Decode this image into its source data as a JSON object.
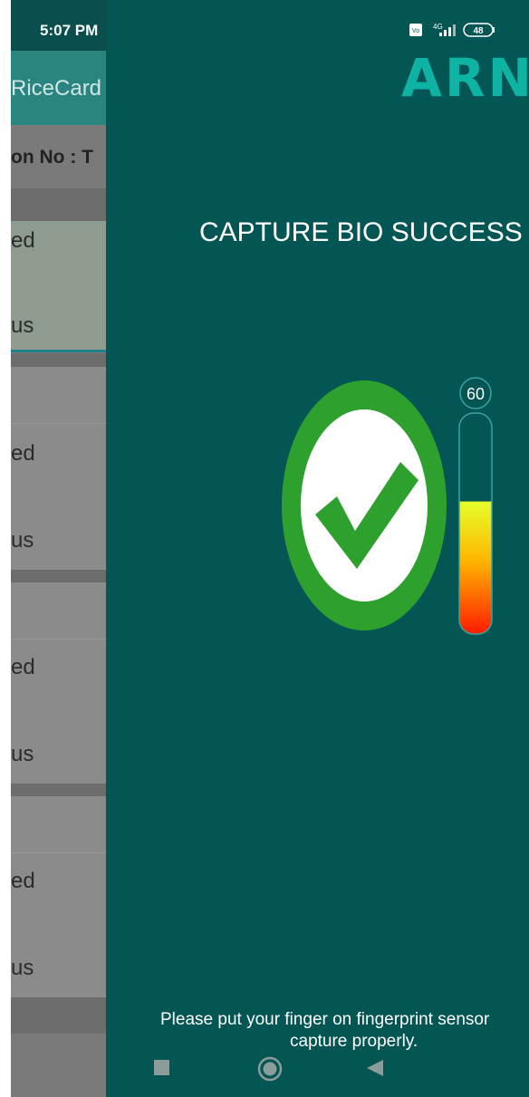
{
  "status_bar": {
    "time": "5:07 PM",
    "battery": "48",
    "network": "4G"
  },
  "background_app": {
    "title": "RiceCard",
    "ration_label": "on No : T",
    "cards": [
      {
        "line1": "ed",
        "line2": "us"
      },
      {
        "line1": "ed",
        "line2": "us"
      },
      {
        "line1": "ed",
        "line2": "us"
      },
      {
        "line1": "ed",
        "line2": "us"
      }
    ]
  },
  "capture_dialog": {
    "brand": "ARNT",
    "headline": "CAPTURE BIO SUCCESS !",
    "quality_value": "60",
    "quality_level": 0.6,
    "hint_line1": "Please put your finger on fingerprint sensor",
    "hint_line2": "capture properly.",
    "colors": {
      "background": "#045654",
      "success_green": "#2ea02e",
      "brand": "#0fb3a4"
    }
  },
  "nav_bar": {
    "recents": "recents-icon",
    "home": "home-icon",
    "back": "back-icon"
  }
}
